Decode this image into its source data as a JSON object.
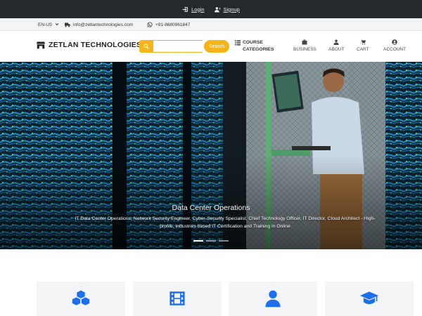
{
  "topbar": {
    "login_label": "Login",
    "signup_label": "Signup",
    "login_icon": "sign-in-icon",
    "signup_icon": "user-plus-icon"
  },
  "infobar": {
    "language": "EN-US",
    "email": "info@zetlantechnologies.com",
    "phone": "+91-8680961847"
  },
  "header": {
    "brand": "ZETLAN TECHNOLOGIES",
    "search_placeholder": "",
    "search_button": "Search",
    "course_categories_line1": "COURSE",
    "course_categories_line2": "CATEGORIES",
    "nav": [
      {
        "label": "BUSINESS",
        "icon": "briefcase-icon"
      },
      {
        "label": "ABOUT",
        "icon": "user-icon"
      },
      {
        "label": "CART",
        "icon": "cart-icon"
      },
      {
        "label": "ACCOUNT",
        "icon": "account-icon"
      }
    ]
  },
  "hero": {
    "title": "Data Center Operations",
    "description": "IT Data Center Operations, Network Security Engineer, Cyber-Security Specialist, Chief Technology Officer, IT Director, Cloud Architect - High-profile, Industries based IT Certification and Training in Online",
    "slides_count": 3,
    "active_slide": 1
  },
  "cards": [
    {
      "icon": "cubes-icon"
    },
    {
      "icon": "film-icon"
    },
    {
      "icon": "user-icon"
    },
    {
      "icon": "graduation-cap-icon"
    }
  ],
  "colors": {
    "accent": "#f3b51b",
    "icon_blue": "#1d6ee8",
    "topbar_bg": "#25292d"
  }
}
